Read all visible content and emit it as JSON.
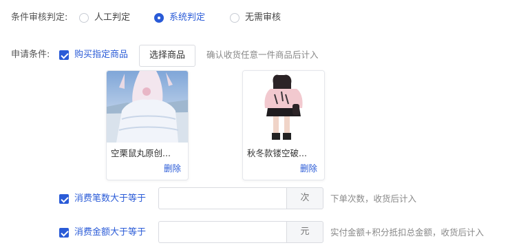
{
  "review": {
    "label": "条件审核判定:",
    "options": [
      {
        "label": "人工判定",
        "checked": false
      },
      {
        "label": "系统判定",
        "checked": true
      },
      {
        "label": "无需审核",
        "checked": false
      }
    ]
  },
  "condition": {
    "label": "申请条件:",
    "buy_label": "购买指定商品",
    "select_button": "选择商品",
    "select_hint": "确认收货任意一件商品后计入"
  },
  "products": [
    {
      "name": "空栗鼠丸原创...",
      "delete_label": "删除"
    },
    {
      "name": "秋冬款镂空破...",
      "delete_label": "删除"
    }
  ],
  "order_count": {
    "label": "消费笔数大于等于",
    "value": "",
    "unit": "次",
    "hint": "下单次数，收货后计入"
  },
  "order_amount": {
    "label": "消费金额大于等于",
    "value": "",
    "unit": "元",
    "hint": "实付金额+积分抵扣总金额，收货后计入"
  },
  "colors": {
    "accent": "#2a5bd7",
    "border": "#d9dbe0"
  }
}
